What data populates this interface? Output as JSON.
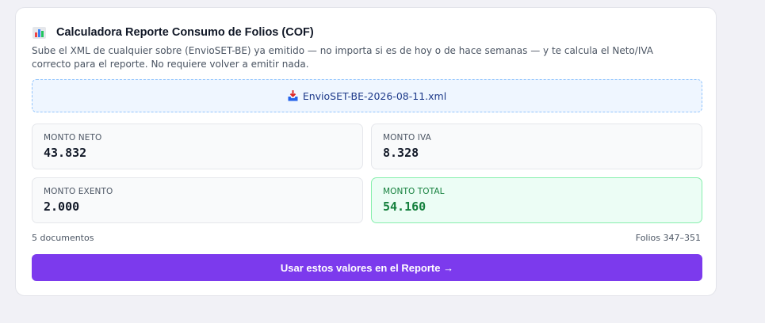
{
  "header": {
    "icon": "bar-chart-icon",
    "title": "Calculadora Reporte Consumo de Folios (COF)",
    "description": "Sube el XML de cualquier sobre (EnvioSET-BE) ya emitido — no importa si es de hoy o de hace semanas — y te calcula el Neto/IVA correcto para el reporte. No requiere volver a emitir nada."
  },
  "upload": {
    "icon": "inbox-tray-icon",
    "file_name": "EnvioSET-BE-2026-08-11.xml"
  },
  "totals": {
    "neto": {
      "label": "MONTO NETO",
      "value": "43.832"
    },
    "iva": {
      "label": "MONTO IVA",
      "value": "8.328"
    },
    "exento": {
      "label": "MONTO EXENTO",
      "value": "2.000"
    },
    "total": {
      "label": "MONTO TOTAL",
      "value": "54.160"
    }
  },
  "summary": {
    "documents": "5 documentos",
    "folios": "Folios 347–351"
  },
  "action": {
    "label": "Usar estos valores en el Reporte →"
  },
  "colors": {
    "accent": "#7c3aed",
    "total_green": "#15803d",
    "dropzone_bg": "#eff6ff"
  }
}
